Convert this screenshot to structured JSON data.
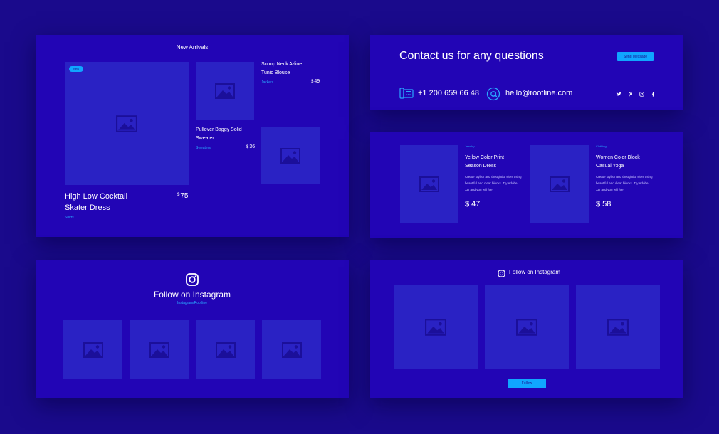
{
  "new_arrivals": {
    "title": "New Arrivals",
    "badge": "New",
    "main_product": {
      "name_line1": "High Low Cocktail",
      "name_line2": "Skater Dress",
      "currency": "$",
      "price": "75",
      "category": "Shirts"
    },
    "product2": {
      "name_line1": "Scoop Neck A-line",
      "name_line2": "Tunic Blouse",
      "currency": "$",
      "price": "49",
      "category": "Jackets"
    },
    "product3": {
      "name_line1": "Pullover Baggy Solid",
      "name_line2": "Sweater",
      "currency": "$",
      "price": "36",
      "category": "Sweaters"
    }
  },
  "contact": {
    "title": "Contact us for any questions",
    "button_label": "Send Message",
    "phone": "+1 200 659 66 48",
    "email": "hello@rootline.com",
    "social_icons": [
      "twitter-icon",
      "pinterest-icon",
      "instagram-icon",
      "facebook-icon"
    ]
  },
  "products_detail": {
    "items": [
      {
        "category": "Jewelry",
        "name_line1": "Yellow Color Print",
        "name_line2": "Season Dress",
        "desc_line1": "Create stylish and thoughtful sites using",
        "desc_line2": "beautiful and clear blocks. Try Adobe",
        "desc_line3": "XD and you will fee",
        "price": "$ 47"
      },
      {
        "category": "Clothing",
        "name_line1": "Women Color Block",
        "name_line2": "Casual Yoga",
        "desc_line1": "Create stylish and thoughtful sites using",
        "desc_line2": "beautiful and clear blocks. Try Adobe",
        "desc_line3": "XD and you will fee",
        "price": "$ 58"
      }
    ]
  },
  "instagram_left": {
    "title": "Follow on Instagram",
    "handle": "Instagram/Rootline"
  },
  "instagram_right": {
    "title": "Follow on Instagram",
    "button_label": "Follow"
  },
  "colors": {
    "background": "#1a0a8c",
    "card": "#2205b5",
    "placeholder": "#2a22c4",
    "accent": "#10a6ff"
  }
}
